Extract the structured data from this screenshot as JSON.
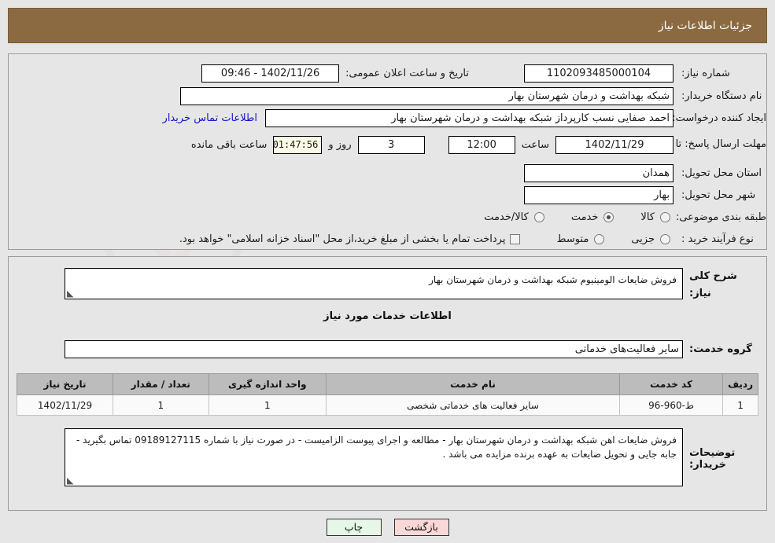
{
  "header": {
    "title": "جزئیات اطلاعات نیاز",
    "bar_color": "#8b6a42"
  },
  "form": {
    "need_number_label": "شماره نیاز:",
    "need_number_value": "1102093485000104",
    "announce_datetime_label": "تاریخ و ساعت اعلان عمومی:",
    "announce_datetime_value": "1402/11/26 - 09:46",
    "buyer_org_label": "نام دستگاه خریدار:",
    "buyer_org_value": "شبکه بهداشت و درمان شهرستان بهار",
    "requester_label": "ایجاد کننده درخواست:",
    "requester_value": "احمد صفایی نسب کارپرداز شبکه بهداشت و درمان شهرستان بهار",
    "contact_link": "اطلاعات تماس خریدار",
    "deadline_label": "مهلت ارسال پاسخ: تا تاریخ:",
    "deadline_date": "1402/11/29",
    "hour_label": "ساعت",
    "deadline_time": "12:00",
    "days_value": "3",
    "days_label": "روز و",
    "countdown_value": "01:47:56",
    "countdown_label": "ساعت باقی مانده",
    "province_label": "استان محل تحویل:",
    "province_value": "همدان",
    "city_label": "شهر محل تحویل:",
    "city_value": "بهار",
    "category_label": "طبقه بندی موضوعی:",
    "category_options": [
      {
        "label": "کالا",
        "checked": false
      },
      {
        "label": "خدمت",
        "checked": true
      },
      {
        "label": "کالا/خدمت",
        "checked": false
      }
    ],
    "process_label": "نوع فرآیند خرید :",
    "process_options": [
      {
        "label": "جزیی",
        "checked": false
      },
      {
        "label": "متوسط",
        "checked": false
      }
    ],
    "treasury_checked": false,
    "treasury_note": "پرداخت تمام یا بخشی از مبلغ خرید،از محل \"اسناد خزانه اسلامی\" خواهد بود."
  },
  "details": {
    "general_desc_label": "شرح کلی نیاز:",
    "general_desc_value": "فروش ضایعات الومینیوم شبکه بهداشت و درمان شهرستان بهار",
    "services_heading": "اطلاعات خدمات مورد نیاز",
    "service_group_label": "گروه خدمت:",
    "service_group_value": "سایر فعالیت‌های خدماتی"
  },
  "table": {
    "columns": [
      "ردیف",
      "کد خدمت",
      "نام خدمت",
      "واحد اندازه گیری",
      "تعداد / مقدار",
      "تاریخ نیاز"
    ],
    "rows": [
      [
        "1",
        "ط-960-96",
        "سایر فعالیت های خدماتی شخصی",
        "1",
        "1",
        "1402/11/29"
      ]
    ]
  },
  "buyer_notes": {
    "label": "توضیحات خریدار:",
    "value": "فروش ضایعات اهن شبکه بهداشت و درمان شهرستان بهار - مطالعه و اجرای پیوست الزامیست - در صورت نیاز با شماره 09189127115 تماس بگیرید - جابه جایی و تحویل ضایعات به عهده برنده مزایده می باشد ."
  },
  "footer": {
    "print_label": "چاپ",
    "back_label": "بازگشت"
  }
}
